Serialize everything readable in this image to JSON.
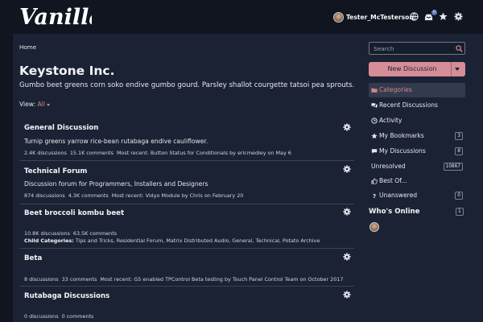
{
  "header": {
    "logo_text": "Vanilla",
    "username": "Tester_McTesterson",
    "notifications_count": "0"
  },
  "breadcrumb": {
    "home": "Home"
  },
  "page": {
    "title": "Keystone Inc.",
    "description": "Gumbo beet greens corn soko endive gumbo gourd. Parsley shallot courgette tatsoi pea sprouts.",
    "view_label": "View:",
    "view_value": "All"
  },
  "categories": [
    {
      "title": "General Discussion",
      "description": "Turnip greens yarrow rice-bean rutabaga endive cauliflower.",
      "discussions": "2.4K discussions",
      "comments": "15.1K comments",
      "recent": "Most recent: Button Status for Conditionals by ericmedley on May 6"
    },
    {
      "title": "Technical Forum",
      "description": "Discussion forum for Programmers, Installers and Designers",
      "discussions": "874 discussions",
      "comments": "4.3K comments",
      "recent": "Most recent: Vidyo Module by Chris on February 20"
    },
    {
      "title": "Beet broccoli kombu beet",
      "description": "",
      "discussions": "10.8K discussions",
      "comments": "63.5K comments",
      "recent": "",
      "child_label": "Child Categories:",
      "child_value": "Tips and Tricks, Residential Forum, Matrix Distributed Audio, General, Technical, Potato Archive"
    },
    {
      "title": "Beta",
      "description": "",
      "discussions": "8 discussions",
      "comments": "33 comments",
      "recent": "Most recent: G5 enabled TPControl Beta testing by Touch Panel Control Team on October 2017"
    },
    {
      "title": "Rutabaga Discussions",
      "description": "",
      "discussions": "0 discussions",
      "comments": "0 comments",
      "recent": ""
    }
  ],
  "sidebar": {
    "search_placeholder": "Search",
    "new_discussion": "New Discussion",
    "nav": [
      {
        "label": "Categories",
        "icon": "folder-icon",
        "count": ""
      },
      {
        "label": "Recent Discussions",
        "icon": "discussions-icon",
        "count": ""
      },
      {
        "label": "Activity",
        "icon": "activity-icon",
        "count": ""
      },
      {
        "label": "My Bookmarks",
        "icon": "star-icon",
        "count": "3"
      },
      {
        "label": "My Discussions",
        "icon": "comment-icon",
        "count": "8"
      },
      {
        "label": "Unresolved",
        "icon": "",
        "count": "10867"
      },
      {
        "label": "Best Of...",
        "icon": "thumbs-up-icon",
        "count": ""
      },
      {
        "label": "Unanswered",
        "icon": "question-icon",
        "count": "0"
      }
    ],
    "whos_online_title": "Who's Online",
    "whos_online_count": "1"
  },
  "colors": {
    "background": "#10151f",
    "panel": "#1a2233",
    "accent": "#d68d97",
    "active_nav": "#323b4d"
  }
}
